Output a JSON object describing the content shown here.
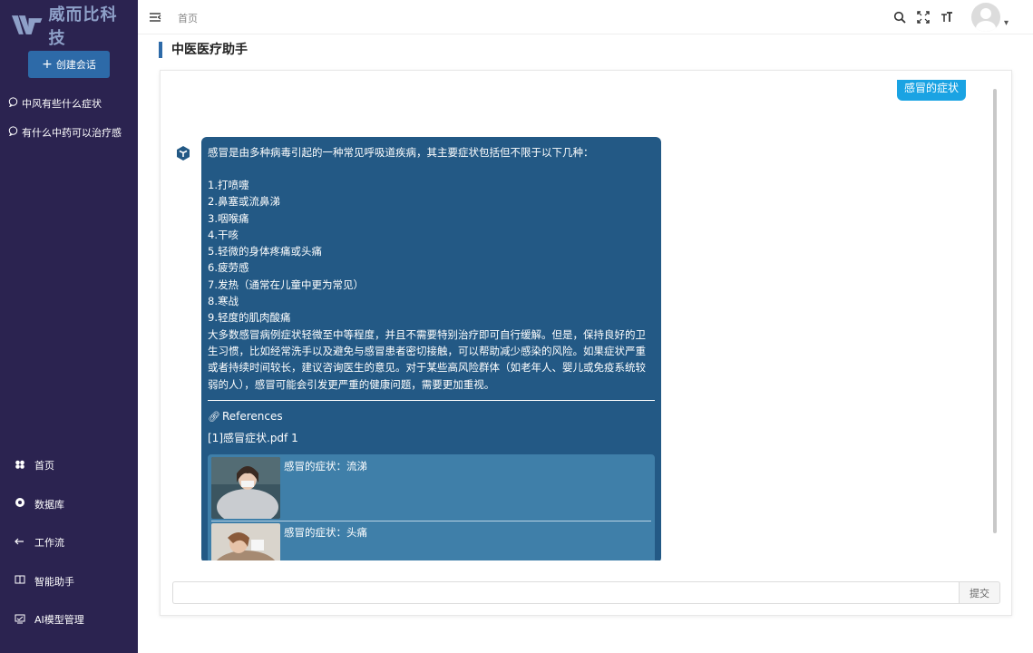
{
  "app": {
    "logo_text": "威而比科技"
  },
  "sidebar": {
    "new_chat_label": "创建会话",
    "conversations": [
      {
        "label": "中风有些什么症状"
      },
      {
        "label": "有什么中药可以治疗感"
      }
    ],
    "nav": [
      {
        "label": "首页",
        "icon": "dashboard-icon"
      },
      {
        "label": "数据库",
        "icon": "database-icon"
      },
      {
        "label": "工作流",
        "icon": "workflow-icon"
      },
      {
        "label": "智能助手",
        "icon": "book-icon"
      },
      {
        "label": "AI模型管理",
        "icon": "model-icon"
      }
    ]
  },
  "topbar": {
    "breadcrumb": "首页"
  },
  "page": {
    "title": "中医医疗助手"
  },
  "chat": {
    "user_message": "感冒的症状",
    "bot": {
      "intro": "感冒是由多种病毒引起的一种常见呼吸道疾病，其主要症状包括但不限于以下几种：",
      "list": [
        "1.打喷嚏",
        "2.鼻塞或流鼻涕",
        "3.咽喉痛",
        "4.干咳",
        "5.轻微的身体疼痛或头痛",
        "6.疲劳感",
        "7.发热（通常在儿童中更为常见）",
        "8.寒战",
        "9.轻度的肌肉酸痛"
      ],
      "paragraph": "大多数感冒病例症状轻微至中等程度，并且不需要特别治疗即可自行缓解。但是，保持良好的卫生习惯，比如经常洗手以及避免与感冒患者密切接触，可以帮助减少感染的风险。如果症状严重或者持续时间较长，建议咨询医生的意见。对于某些高风险群体（如老年人、婴儿或免疫系统较弱的人），感冒可能会引发更严重的健康问题，需要更加重视。",
      "references_title": "References",
      "reference_line": "[1]感冒症状.pdf   1",
      "reference_cards": [
        {
          "title": "感冒的症状：流涕"
        },
        {
          "title": "感冒的症状：头痛"
        }
      ]
    }
  },
  "input": {
    "value": "",
    "placeholder": "",
    "submit_label": "提交"
  }
}
